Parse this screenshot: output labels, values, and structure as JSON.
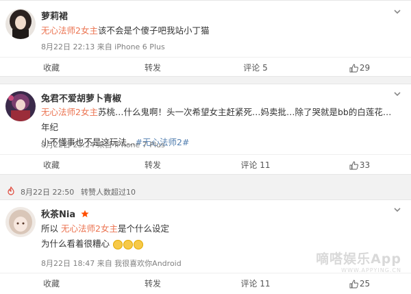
{
  "posts": [
    {
      "name": "萝莉裙",
      "content_hl": "无心法师2女主",
      "content_rest": "该不会是个傻子吧我站小丁猫",
      "meta": "8月22日 22:13 来自 iPhone 6 Plus",
      "actions": {
        "collect": "收藏",
        "repost": "转发",
        "comment": "评论 5",
        "like": "29"
      }
    },
    {
      "name": "兔君不爱胡萝卜青椒",
      "content_hl": "无心法师2女主",
      "content_rest_1": "苏桃…什么鬼啊！头一次希望女主赶紧死…妈卖批…除了哭就是bb的白莲花…年纪",
      "content_rest_2": "小不懂事也不是这玩法…",
      "tag": "#无心法师2#",
      "meta": "8月22日 23:24 来自 iPhone 7 Plus",
      "actions": {
        "collect": "收藏",
        "repost": "转发",
        "comment": "评论 11",
        "like": "33"
      }
    },
    {
      "name": "秋茶Nia",
      "content_pre": "所以",
      "content_hl": "无心法师2女主",
      "content_rest": "是个什么设定",
      "content_line2": "为什么看着很糟心",
      "meta": "8月22日 18:47 来自 我很喜欢你Android",
      "actions": {
        "collect": "收藏",
        "repost": "转发",
        "comment": "评论 11",
        "like": "25"
      }
    }
  ],
  "verify_bar": {
    "time": "8月22日 22:50",
    "text": "转赞人数超过10"
  },
  "watermark": {
    "main": "嘀嗒娱乐App",
    "sub": "WWW.APPYING.CN"
  },
  "colors": {
    "highlight": "#eb7350",
    "tag": "#507daf",
    "verified_star": "#ff4e00"
  },
  "icons": [
    "chevron-down-icon",
    "thumbs-up-icon",
    "star-icon",
    "fire-icon",
    "laughing-crying-emoji"
  ]
}
